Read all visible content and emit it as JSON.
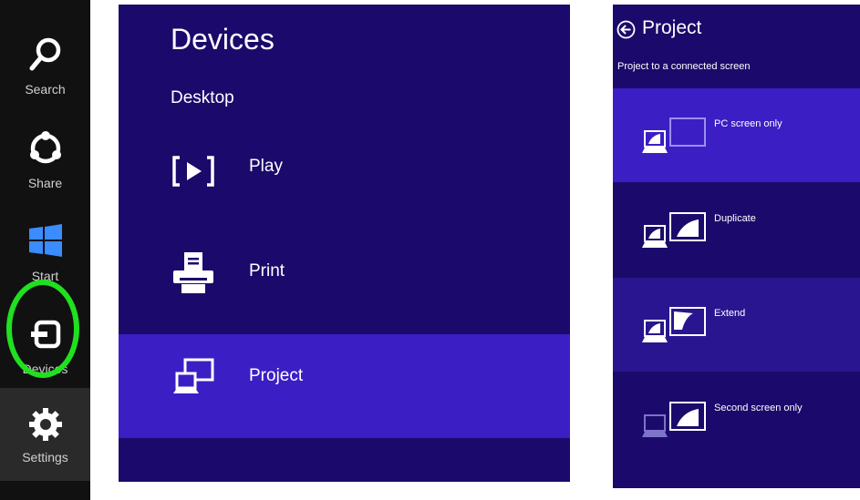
{
  "charms": {
    "items": [
      {
        "label": "Search"
      },
      {
        "label": "Share"
      },
      {
        "label": "Start"
      },
      {
        "label": "Devices"
      },
      {
        "label": "Settings"
      }
    ]
  },
  "devices_panel": {
    "title": "Devices",
    "subtitle": "Desktop",
    "items": [
      {
        "label": "Play",
        "icon": "play-icon"
      },
      {
        "label": "Print",
        "icon": "printer-icon"
      },
      {
        "label": "Project",
        "icon": "project-icon",
        "selected": true
      }
    ]
  },
  "project_panel": {
    "title": "Project",
    "subtitle": "Project to a connected screen",
    "options": [
      {
        "label": "PC screen only",
        "icon": "pc-screen-only-icon",
        "selected": true
      },
      {
        "label": "Duplicate",
        "icon": "duplicate-icon"
      },
      {
        "label": "Extend",
        "icon": "extend-icon"
      },
      {
        "label": "Second screen only",
        "icon": "second-screen-only-icon"
      }
    ]
  },
  "colors": {
    "charms_bg": "#111111",
    "panel_bg": "#1b0a6b",
    "selected_bg": "#3b1fc4",
    "highlight": "#20e020"
  }
}
